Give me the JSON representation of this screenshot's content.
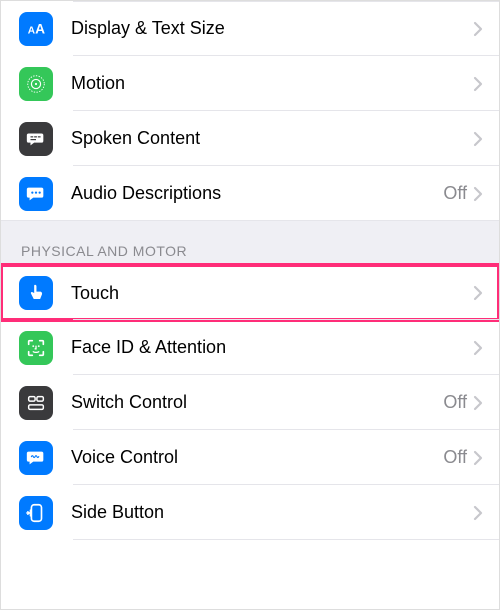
{
  "groups": {
    "vision": {
      "items": {
        "display": {
          "label": "Display & Text Size"
        },
        "motion": {
          "label": "Motion"
        },
        "spoken": {
          "label": "Spoken Content"
        },
        "audiodesc": {
          "label": "Audio Descriptions",
          "value": "Off"
        }
      }
    },
    "physical": {
      "header": "PHYSICAL AND MOTOR",
      "items": {
        "touch": {
          "label": "Touch"
        },
        "faceid": {
          "label": "Face ID & Attention"
        },
        "switchctrl": {
          "label": "Switch Control",
          "value": "Off"
        },
        "voicectrl": {
          "label": "Voice Control",
          "value": "Off"
        },
        "sidebutton": {
          "label": "Side Button"
        }
      }
    }
  }
}
